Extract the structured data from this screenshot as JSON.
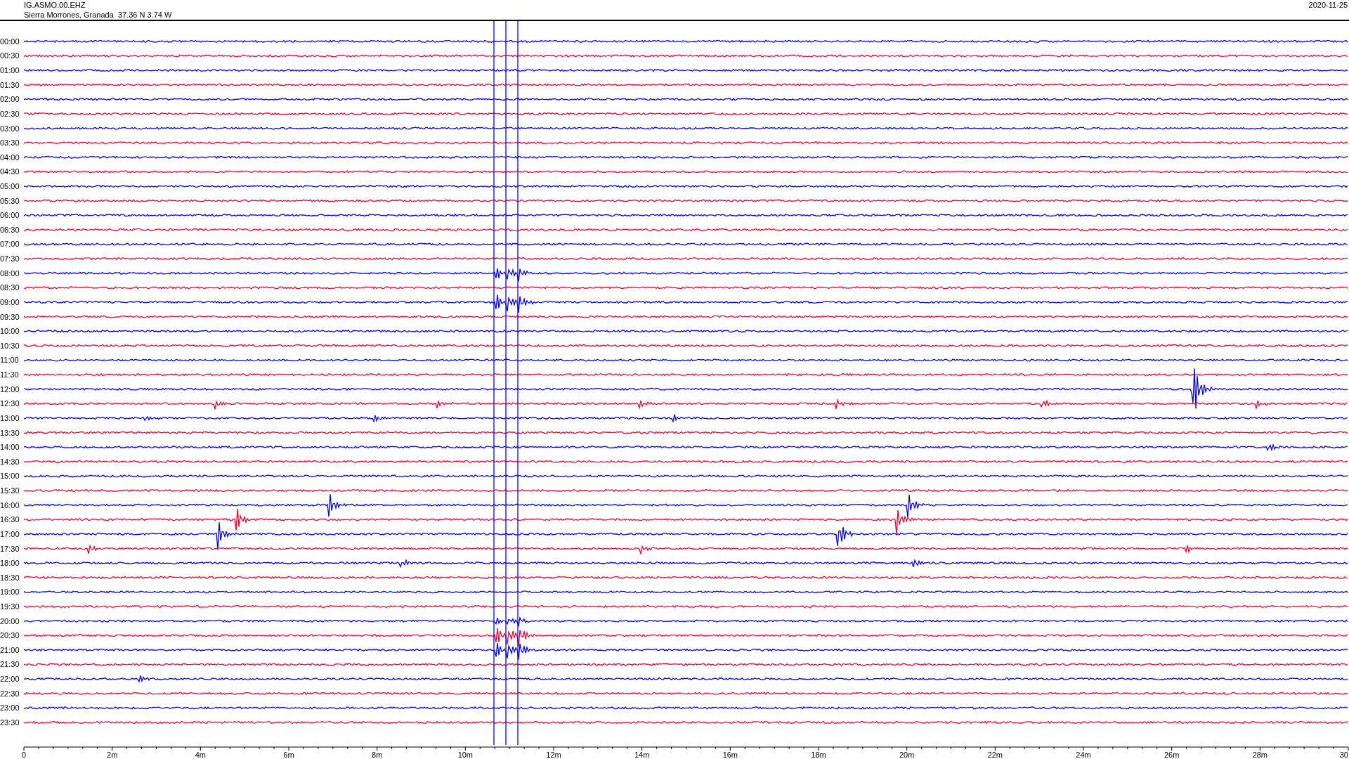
{
  "header": {
    "station": "IG.ASMO.00.EHZ",
    "location": "Sierra Morrones, Granada  37.36 N 3.74 W",
    "date": "2020-11-25"
  },
  "traces": [
    {
      "label": "00:00",
      "color": "#0000ff"
    },
    {
      "label": "00:30",
      "color": "#ff0033"
    },
    {
      "label": "01:00",
      "color": "#0000ff"
    },
    {
      "label": "01:30",
      "color": "#ff0033"
    },
    {
      "label": "02:00",
      "color": "#0000ff"
    },
    {
      "label": "02:30",
      "color": "#ff0033"
    },
    {
      "label": "03:00",
      "color": "#0000ff"
    },
    {
      "label": "03:30",
      "color": "#ff0033"
    },
    {
      "label": "04:00",
      "color": "#0000ff"
    },
    {
      "label": "04:30",
      "color": "#ff0033"
    },
    {
      "label": "05:00",
      "color": "#0000ff"
    },
    {
      "label": "05:30",
      "color": "#ff0033"
    },
    {
      "label": "06:00",
      "color": "#0000ff"
    },
    {
      "label": "06:30",
      "color": "#ff0033"
    },
    {
      "label": "07:00",
      "color": "#0000ff"
    },
    {
      "label": "07:30",
      "color": "#ff0033"
    },
    {
      "label": "08:00",
      "color": "#0000ff"
    },
    {
      "label": "08:30",
      "color": "#ff0033"
    },
    {
      "label": "09:00",
      "color": "#0000ff"
    },
    {
      "label": "09:30",
      "color": "#ff0033"
    },
    {
      "label": "10:00",
      "color": "#0000ff"
    },
    {
      "label": "10:30",
      "color": "#ff0033"
    },
    {
      "label": "11:00",
      "color": "#0000ff"
    },
    {
      "label": "11:30",
      "color": "#ff0033"
    },
    {
      "label": "12:00",
      "color": "#0000ff"
    },
    {
      "label": "12:30",
      "color": "#ff0033"
    },
    {
      "label": "13:00",
      "color": "#0000ff"
    },
    {
      "label": "13:30",
      "color": "#ff0033"
    },
    {
      "label": "14:00",
      "color": "#0000ff"
    },
    {
      "label": "14:30",
      "color": "#ff0033"
    },
    {
      "label": "15:00",
      "color": "#0000ff"
    },
    {
      "label": "15:30",
      "color": "#ff0033"
    },
    {
      "label": "16:00",
      "color": "#0000ff"
    },
    {
      "label": "16:30",
      "color": "#ff0033"
    },
    {
      "label": "17:00",
      "color": "#0000ff"
    },
    {
      "label": "17:30",
      "color": "#ff0033"
    },
    {
      "label": "18:00",
      "color": "#0000ff"
    },
    {
      "label": "18:30",
      "color": "#ff0033"
    },
    {
      "label": "19:00",
      "color": "#0000ff"
    },
    {
      "label": "19:30",
      "color": "#ff0033"
    },
    {
      "label": "20:00",
      "color": "#0000ff"
    },
    {
      "label": "20:30",
      "color": "#ff0033"
    },
    {
      "label": "21:00",
      "color": "#0000ff"
    },
    {
      "label": "21:30",
      "color": "#ff0033"
    },
    {
      "label": "22:00",
      "color": "#0000ff"
    },
    {
      "label": "22:30",
      "color": "#ff0033"
    },
    {
      "label": "23:00",
      "color": "#0000ff"
    },
    {
      "label": "23:30",
      "color": "#ff0033"
    }
  ],
  "x_axis": {
    "labels": [
      "0",
      "2m",
      "4m",
      "6m",
      "8m",
      "10m",
      "12m",
      "14m",
      "16m",
      "18m",
      "20m",
      "22m",
      "24m",
      "26m",
      "28m",
      "30"
    ]
  }
}
